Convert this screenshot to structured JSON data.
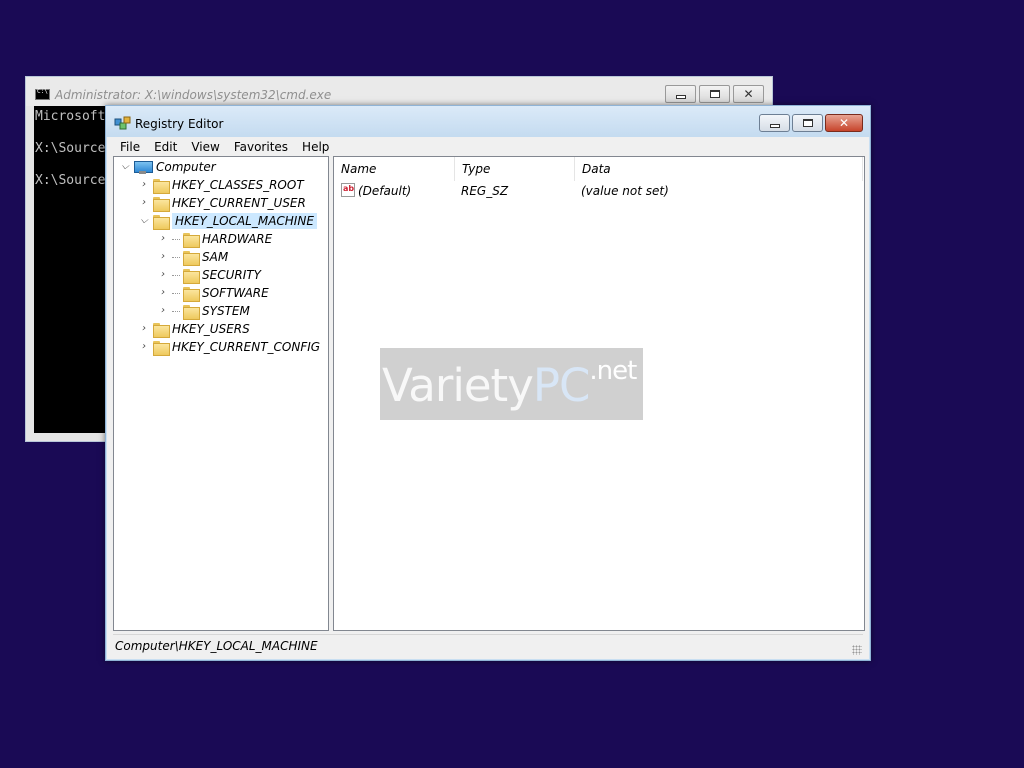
{
  "cmd": {
    "title": "Administrator: X:\\windows\\system32\\cmd.exe",
    "lines": [
      "Microsoft",
      "",
      "X:\\Source",
      "",
      "X:\\Source"
    ]
  },
  "regedit": {
    "title": "Registry Editor",
    "menu": [
      "File",
      "Edit",
      "View",
      "Favorites",
      "Help"
    ],
    "tree": {
      "root": "Computer",
      "hives": [
        "HKEY_CLASSES_ROOT",
        "HKEY_CURRENT_USER",
        "HKEY_LOCAL_MACHINE",
        "HKEY_USERS",
        "HKEY_CURRENT_CONFIG"
      ],
      "selected": "HKEY_LOCAL_MACHINE",
      "children": [
        "HARDWARE",
        "SAM",
        "SECURITY",
        "SOFTWARE",
        "SYSTEM"
      ]
    },
    "columns": [
      "Name",
      "Type",
      "Data"
    ],
    "values": [
      {
        "name": "(Default)",
        "type": "REG_SZ",
        "data": "(value not set)"
      }
    ],
    "status": "Computer\\HKEY_LOCAL_MACHINE"
  },
  "watermark": {
    "part1": "Variety",
    "part2": "PC",
    "part3": ".net"
  },
  "colors": {
    "desktop": "#1a0a55",
    "selection": "#cce8ff",
    "close": "#c7442b"
  }
}
